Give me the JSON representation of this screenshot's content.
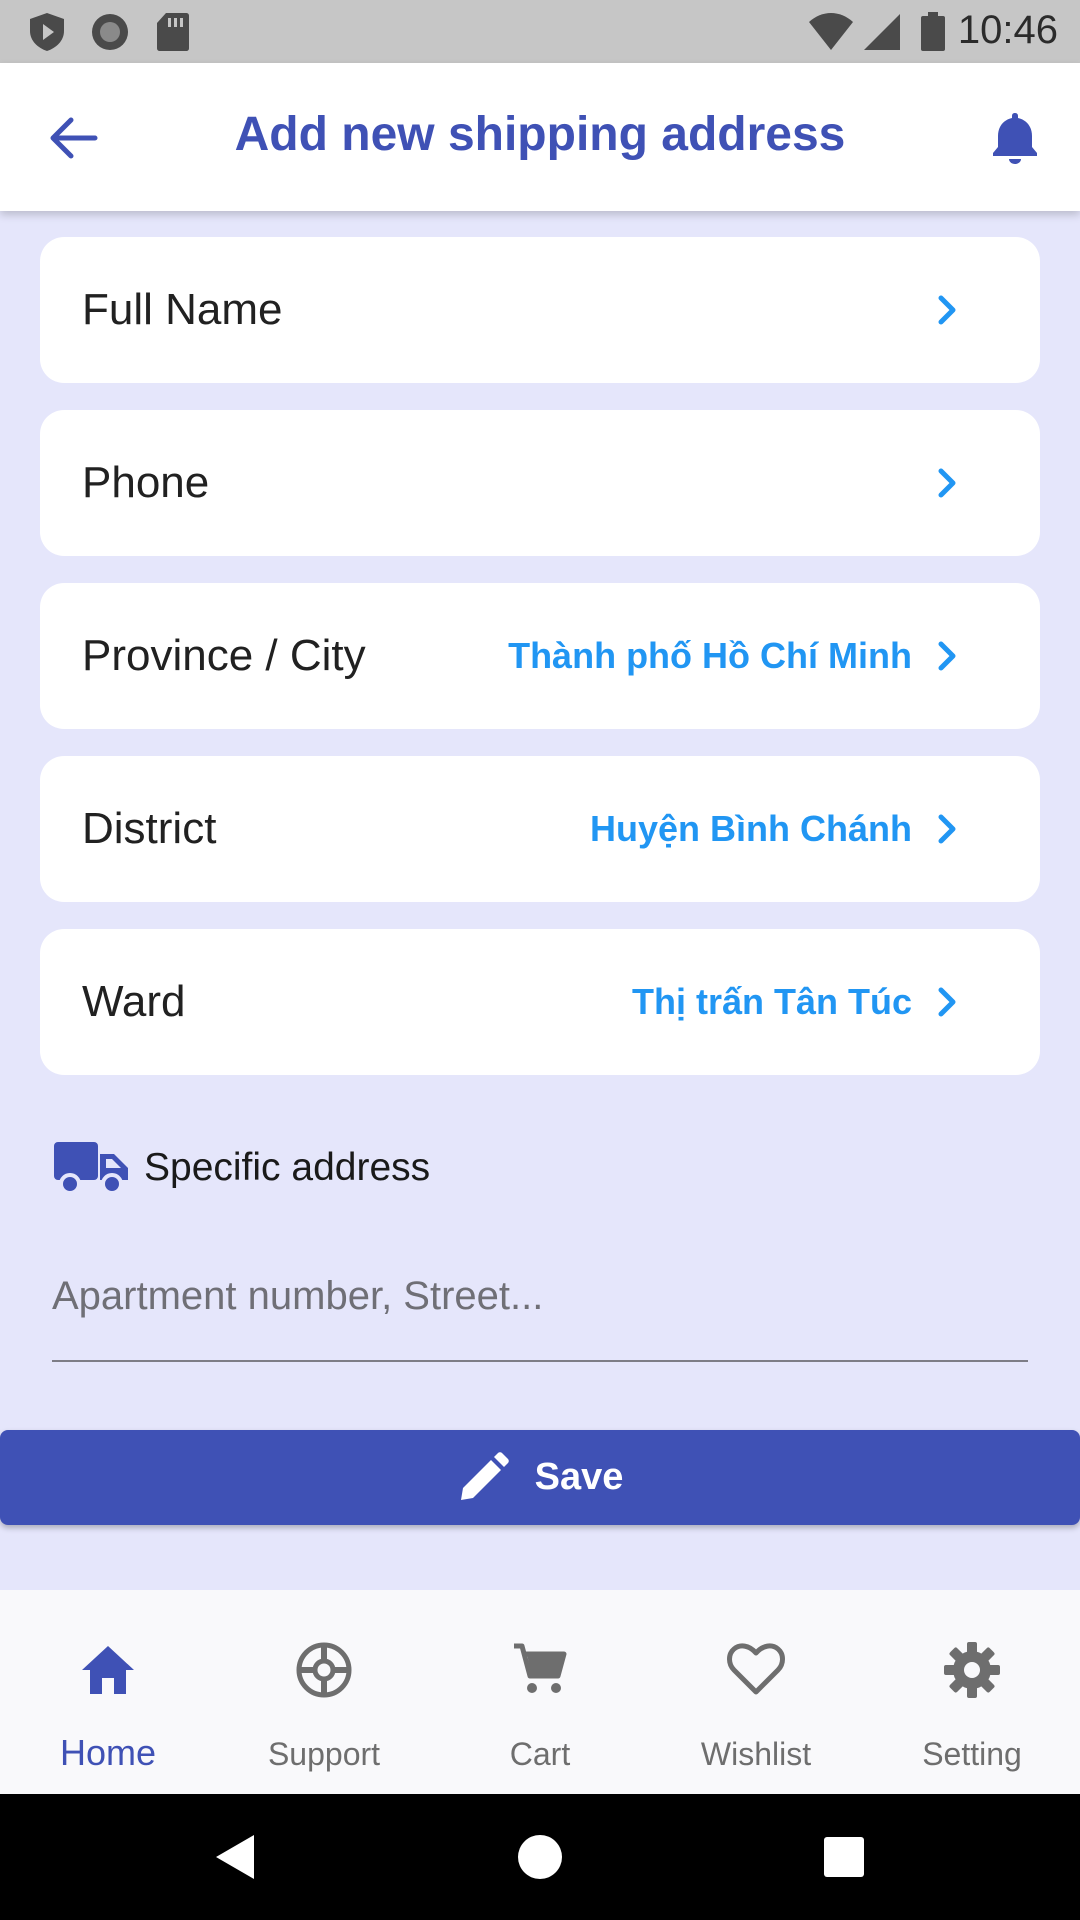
{
  "status_bar": {
    "time": "10:46",
    "icons": [
      "shield-play-icon",
      "record-icon",
      "sd-card-icon",
      "wifi-icon",
      "signal-icon",
      "battery-icon"
    ]
  },
  "app_bar": {
    "title": "Add new shipping address",
    "back_icon": "arrow-back-icon",
    "notification_icon": "bell-icon"
  },
  "form": {
    "rows": [
      {
        "label": "Full Name",
        "value": ""
      },
      {
        "label": "Phone",
        "value": ""
      },
      {
        "label": "Province / City",
        "value": "Thành phố Hồ Chí Minh"
      },
      {
        "label": "District",
        "value": "Huyện Bình Chánh"
      },
      {
        "label": "Ward",
        "value": "Thị trấn Tân Túc"
      }
    ],
    "specific_address": {
      "label": "Specific address",
      "icon": "truck-icon",
      "value": "",
      "placeholder": "Apartment number, Street..."
    }
  },
  "save_button": {
    "label": "Save",
    "icon": "pencil-icon"
  },
  "bottom_nav": {
    "items": [
      {
        "label": "Home",
        "icon": "home-icon",
        "active": true
      },
      {
        "label": "Support",
        "icon": "lifebuoy-icon",
        "active": false
      },
      {
        "label": "Cart",
        "icon": "cart-icon",
        "active": false
      },
      {
        "label": "Wishlist",
        "icon": "heart-icon",
        "active": false
      },
      {
        "label": "Setting",
        "icon": "gear-icon",
        "active": false
      }
    ]
  },
  "colors": {
    "primary": "#3f51b5",
    "value_text": "#2196f3",
    "background": "#e5e6fb",
    "inactive": "#6e6e6e"
  }
}
